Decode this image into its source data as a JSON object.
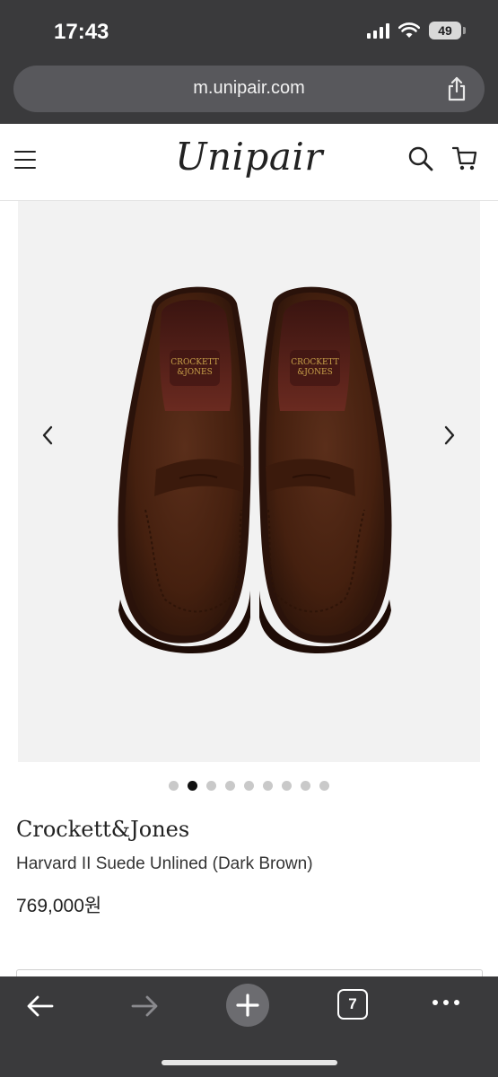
{
  "status_bar": {
    "time": "17:43",
    "battery": "49",
    "icons": [
      "signal-icon",
      "wifi-icon",
      "battery-icon"
    ]
  },
  "browser": {
    "url": "m.unipair.com",
    "open_tabs": "7",
    "toolbar_icons": [
      "back-arrow-icon",
      "forward-arrow-icon",
      "new-tab-plus-icon",
      "tabs-icon",
      "more-icon"
    ]
  },
  "header": {
    "logo": "Unipair",
    "icons": [
      "menu-icon",
      "search-icon",
      "cart-icon"
    ]
  },
  "gallery": {
    "image_count": 9,
    "active_index": 1,
    "image_description_icon": "loafer-shoes-image"
  },
  "product": {
    "brand": "Crockett&Jones",
    "name": "Harvard II Suede Unlined (Dark Brown)",
    "price": "769,000원"
  },
  "colors": {
    "browser_chrome": "#3a3a3c",
    "url_bar": "#58585c",
    "image_bg": "#f2f2f2",
    "suede_brown": "#4a2414",
    "dot_active": "#111111",
    "dot_inactive": "#c9c9c9"
  }
}
